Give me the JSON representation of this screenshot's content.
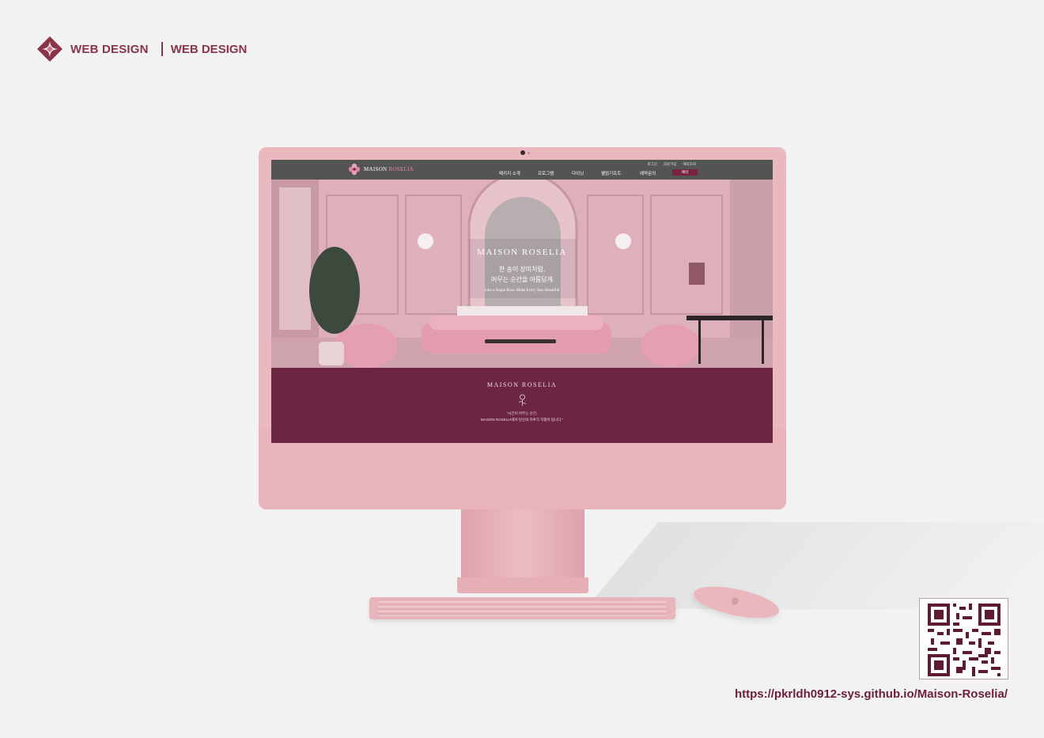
{
  "header": {
    "brand_title": "WEB DESIGN",
    "brand_subtitle": "WEB DESIGN",
    "logo_icon": "diamond-star-icon"
  },
  "site": {
    "logo_text_main": "MAISON ",
    "logo_text_accent": "ROSELIA",
    "utility_links": [
      "로그인",
      "회원가입",
      "예약조회"
    ],
    "menu_items": [
      "패키지 소개",
      "프로그램",
      "다이닝",
      "웰컴기프트",
      "예약문의"
    ],
    "reserve_button": "예약",
    "hero": {
      "title": "MAISON ROSELIA",
      "line1": "한 송이 장미처럼,",
      "line2": "머무는 순간을 아름답게",
      "subtitle": "Like a Single Rose, Make Every Stay Beautiful"
    },
    "brand_section": {
      "title": "MAISON ROSELIA",
      "quote_line1": "\"시간이 머무는 순간,",
      "quote_line2": "MAISON ROSELIA에서 당신의 하루가 작품이 됩니다.\""
    }
  },
  "footer": {
    "url": "https://pkrldh0912-sys.github.io/Maison-Roselia/"
  },
  "colors": {
    "brand_burgundy": "#8a3547",
    "section_burgundy": "#6d2642",
    "device_pink": "#eab8bf",
    "nav_gray": "#545454"
  }
}
